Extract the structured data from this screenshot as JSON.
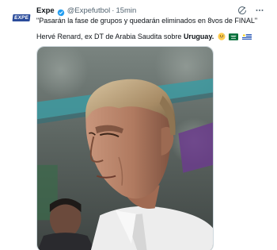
{
  "tweet": {
    "author": {
      "name": "Expe",
      "handle": "@Expefutbol",
      "separator": "·",
      "time": "15min",
      "avatar_logo": "EXPE",
      "verified_badge_icon": "verified-badge-icon"
    },
    "actions": {
      "grok_icon": "grok-icon",
      "more_icon": "more-icon"
    },
    "text": {
      "line1": "\"Pasarán la fase de grupos y quedarán eliminados en 8vos de FINAL\"",
      "line2_prefix": "Hervé Renard, ex DT de Arabia Saudita sobre ",
      "line2_bold": "Uruguay.",
      "emojis": [
        "grinning-sweat-emoji",
        "saudi-flag-emoji",
        "uruguay-flag-emoji"
      ]
    },
    "media": {
      "image_name": "coach-portrait-photo"
    }
  },
  "colors": {
    "text_primary": "#0f1419",
    "text_secondary": "#536471",
    "verified_blue": "#1d9bf0",
    "border": "#cfd9de"
  }
}
